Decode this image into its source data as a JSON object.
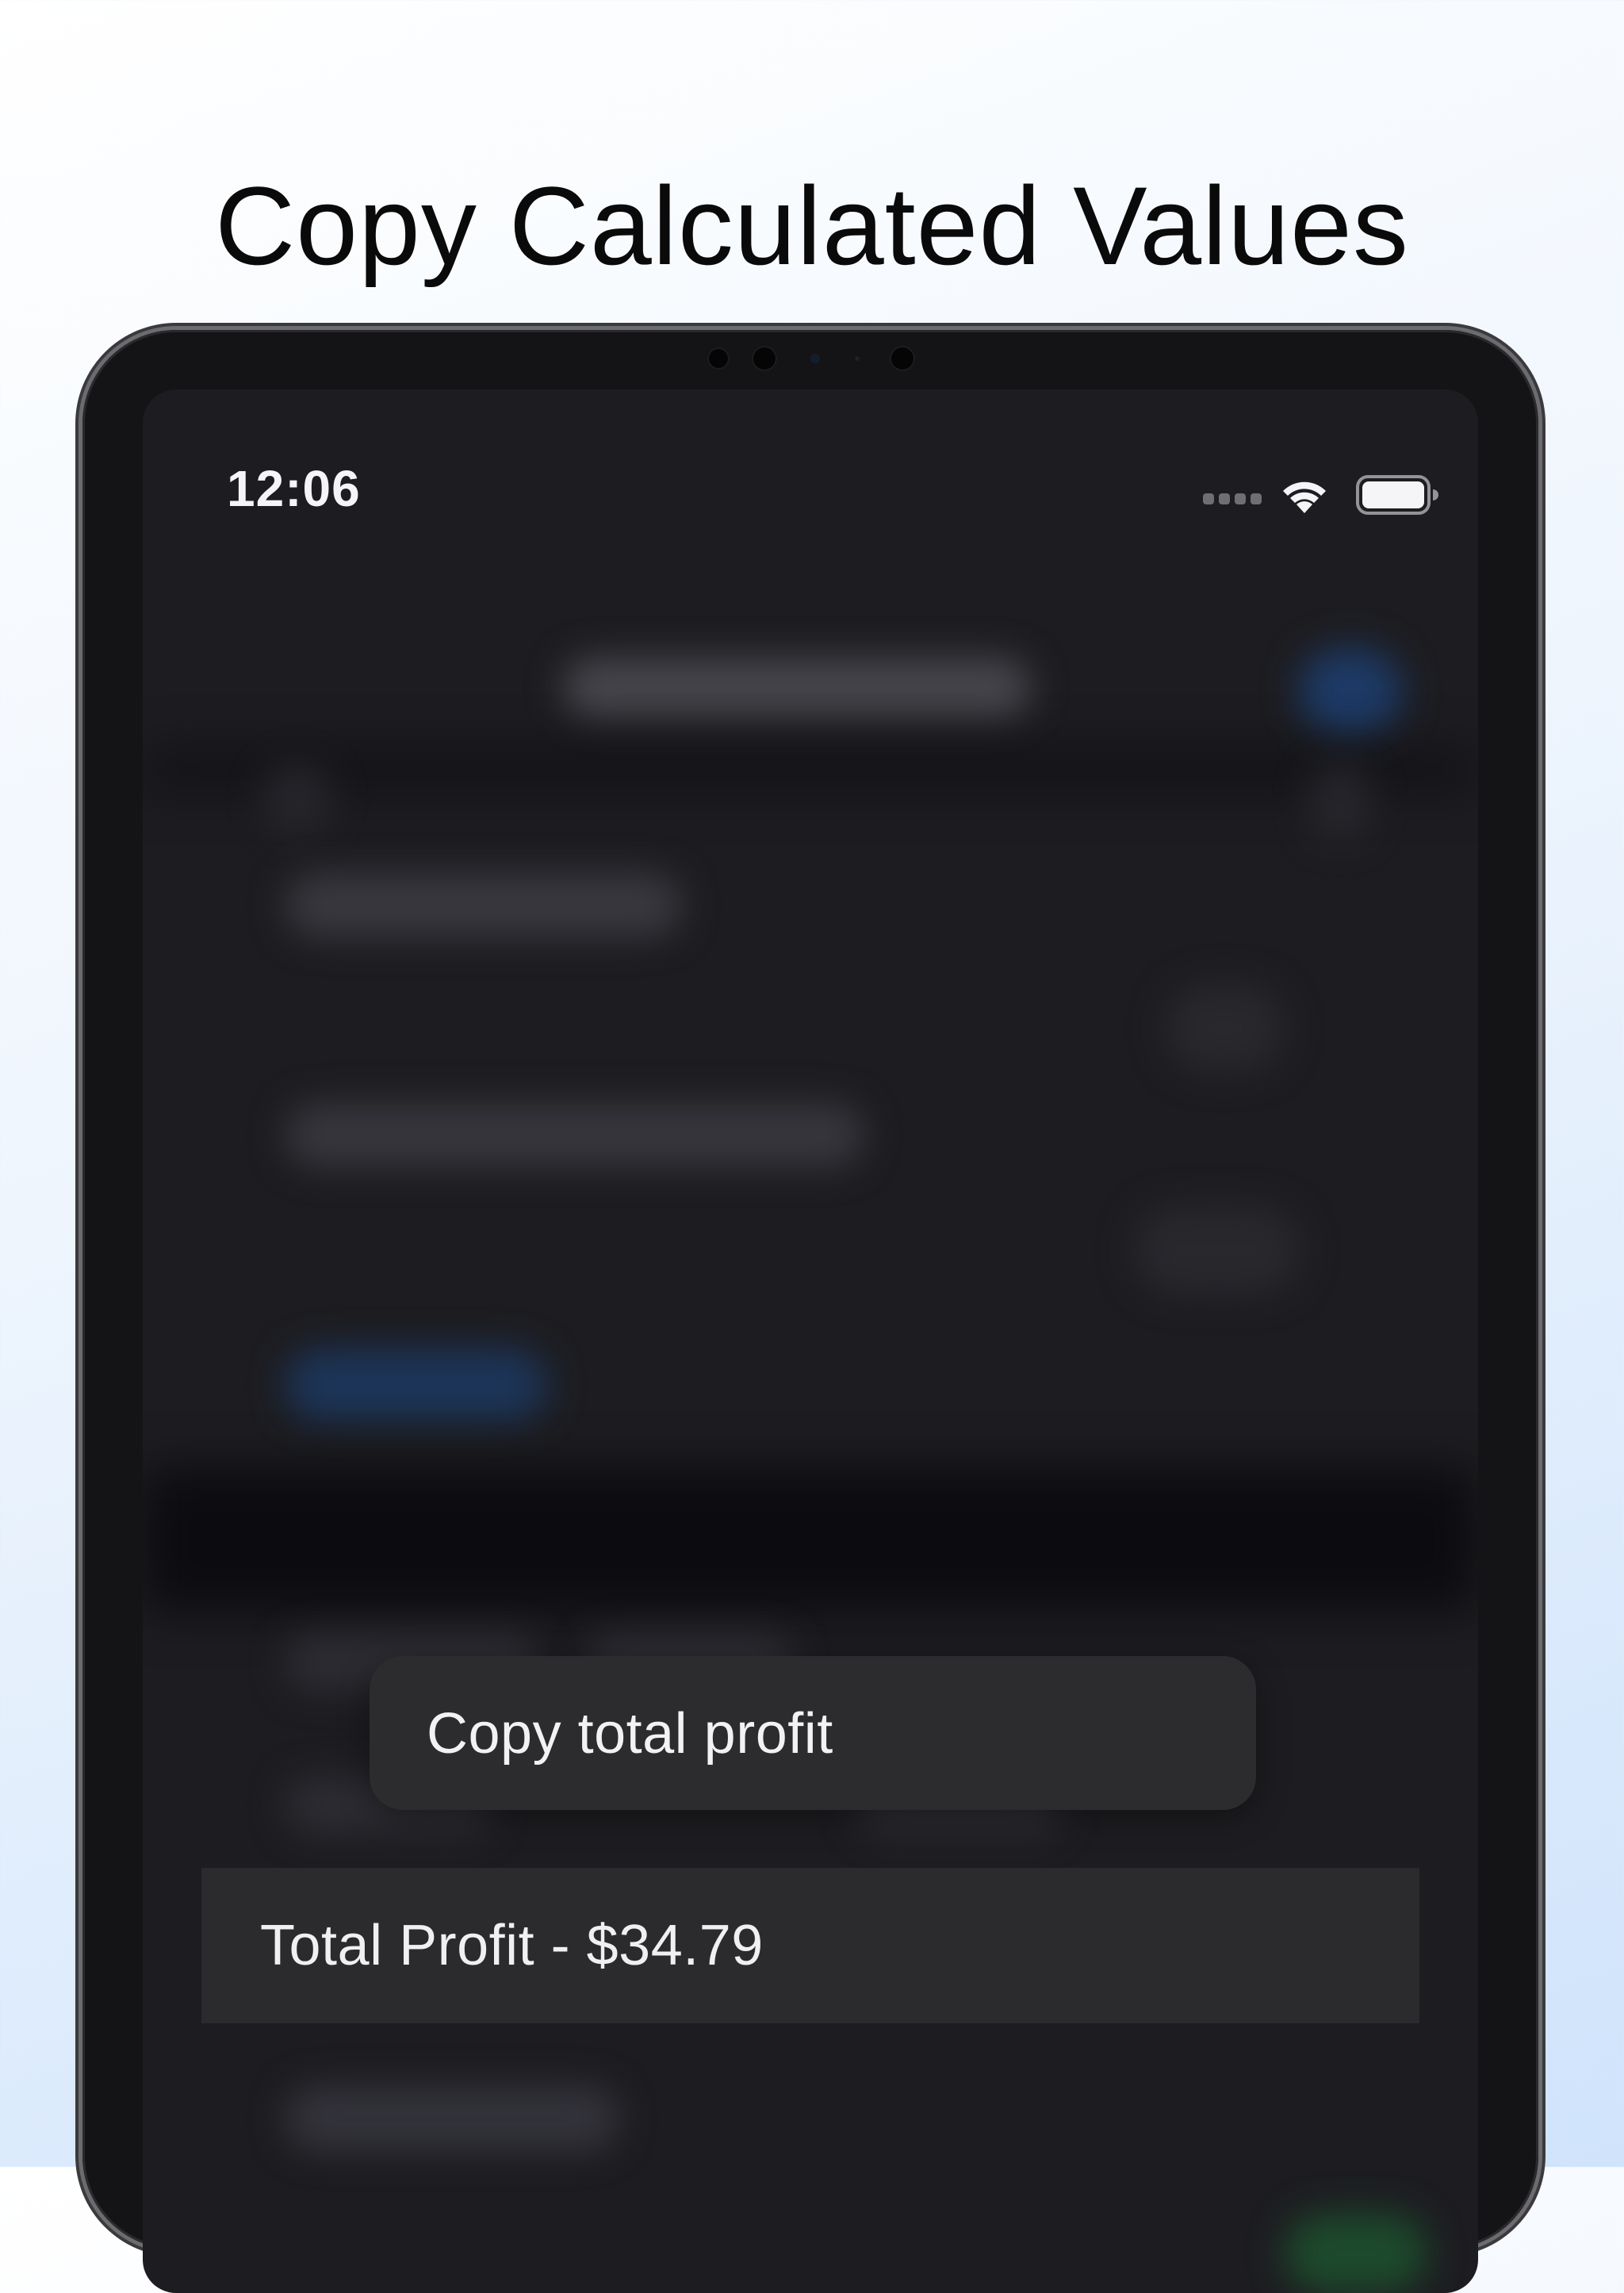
{
  "headline": "Copy Calculated Values",
  "status_bar": {
    "time": "12:06",
    "wifi_icon": "wifi-icon",
    "battery_icon": "battery-full-icon"
  },
  "context_menu": {
    "items": [
      {
        "label": "Copy total profit"
      }
    ]
  },
  "highlighted_row": {
    "label": "Total Profit - $34.79"
  }
}
